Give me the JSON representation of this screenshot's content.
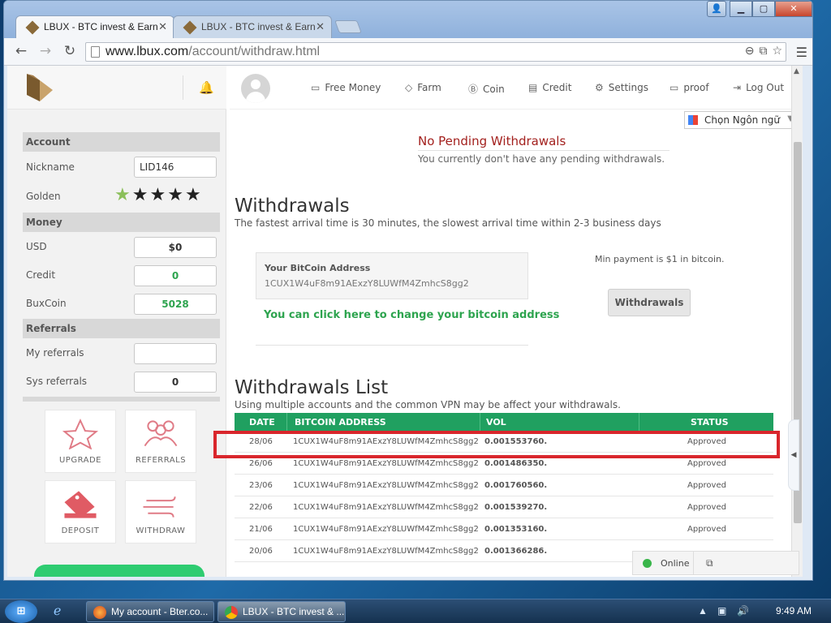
{
  "browser": {
    "tabs": [
      {
        "title": "LBUX - BTC invest & Earn",
        "active": true
      },
      {
        "title": "LBUX - BTC invest & Earn",
        "active": false
      }
    ],
    "url_host": "www.lbux.com",
    "url_path": "/account/withdraw.html"
  },
  "sidebar": {
    "account_title": "Account",
    "nickname_label": "Nickname",
    "nickname_value": "LID146",
    "golden_label": "Golden",
    "golden_stars": 5,
    "money_title": "Money",
    "usd_label": "USD",
    "usd_value": "$0",
    "credit_label": "Credit",
    "credit_value": "0",
    "buxcoin_label": "BuxCoin",
    "buxcoin_value": "5028",
    "referrals_title": "Referrals",
    "my_referrals_label": "My referrals",
    "my_referrals_value": "",
    "sys_referrals_label": "Sys referrals",
    "sys_referrals_value": "0",
    "tiles": {
      "upgrade": "UPGRADE",
      "referrals": "REFERRALS",
      "deposit": "DEPOSIT",
      "withdraw": "WITHDRAW"
    }
  },
  "nav": {
    "free_money": "Free Money",
    "farm": "Farm",
    "coin": "Coin",
    "credit": "Credit",
    "settings": "Settings",
    "proof": "proof",
    "logout": "Log Out"
  },
  "translate": {
    "label": "Chọn Ngôn ngữ"
  },
  "pending": {
    "title": "No Pending Withdrawals",
    "text": "You currently don't have any pending withdrawals."
  },
  "withdrawals": {
    "heading": "Withdrawals",
    "subtitle": "The fastest arrival time is 30 minutes, the slowest arrival time within 2-3 business days",
    "address_label": "Your BitCoin Address",
    "address_value": "1CUX1W4uF8m91AExzY8LUWfM4ZmhcS8gg2",
    "change_link": "You can click here to change your bitcoin address",
    "min_payment": "Min payment is $1 in bitcoin.",
    "button": "Withdrawals"
  },
  "list": {
    "heading": "Withdrawals List",
    "subtitle": "Using multiple accounts and the common VPN may be affect your withdrawals.",
    "columns": [
      "DATE",
      "BITCOIN ADDRESS",
      "VOL",
      "STATUS"
    ],
    "rows": [
      {
        "date": "28/06",
        "address": "1CUX1W4uF8m91AExzY8LUWfM4ZmhcS8gg2",
        "vol": "0.001553760.",
        "status": "Approved"
      },
      {
        "date": "26/06",
        "address": "1CUX1W4uF8m91AExzY8LUWfM4ZmhcS8gg2",
        "vol": "0.001486350.",
        "status": "Approved"
      },
      {
        "date": "23/06",
        "address": "1CUX1W4uF8m91AExzY8LUWfM4ZmhcS8gg2",
        "vol": "0.001760560.",
        "status": "Approved"
      },
      {
        "date": "22/06",
        "address": "1CUX1W4uF8m91AExzY8LUWfM4ZmhcS8gg2",
        "vol": "0.001539270.",
        "status": "Approved"
      },
      {
        "date": "21/06",
        "address": "1CUX1W4uF8m91AExzY8LUWfM4ZmhcS8gg2",
        "vol": "0.001353160.",
        "status": "Approved"
      },
      {
        "date": "20/06",
        "address": "1CUX1W4uF8m91AExzY8LUWfM4ZmhcS8gg2",
        "vol": "0.001366286.",
        "status": ""
      }
    ]
  },
  "chat": {
    "status": "Online"
  },
  "taskbar": {
    "items": [
      "My account - Bter.co...",
      "LBUX - BTC invest & ..."
    ],
    "clock": "9:49 AM"
  },
  "colors": {
    "accent_green": "#20a060",
    "link_green": "#2ea44f",
    "alert_red": "#a3211e",
    "highlight": "#d9262c"
  }
}
